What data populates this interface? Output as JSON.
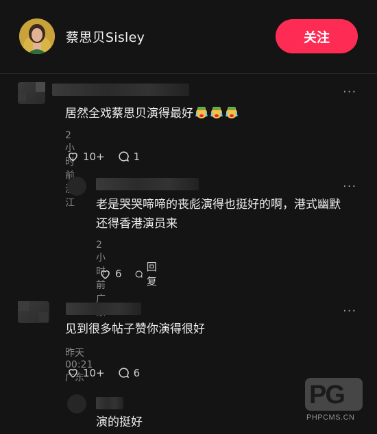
{
  "header": {
    "username": "蔡思贝Sisley",
    "follow_label": "关注"
  },
  "comments": [
    {
      "text": "居然全戏蔡思贝演得最好",
      "emoji_count": 3,
      "meta": "2小时前 浙江",
      "likes": "10+",
      "replies": "1"
    },
    {
      "text_line1": "老是哭哭啼啼的丧彪演得也挺好的啊，港式幽默",
      "text_line2": "还得香港演员来",
      "meta": "2小时前 广东",
      "likes": "6",
      "reply_label": "回复"
    },
    {
      "text": "见到很多帖子赞你演得很好",
      "meta": "昨天 00:21 广东",
      "likes": "10+",
      "replies": "6"
    },
    {
      "text": "演的挺好"
    }
  ],
  "more_label": "···",
  "watermark": {
    "letters": "PG",
    "site": "PHPCMS.CN"
  },
  "colors": {
    "background": "#141414",
    "follow_button": "#fe2c55"
  }
}
